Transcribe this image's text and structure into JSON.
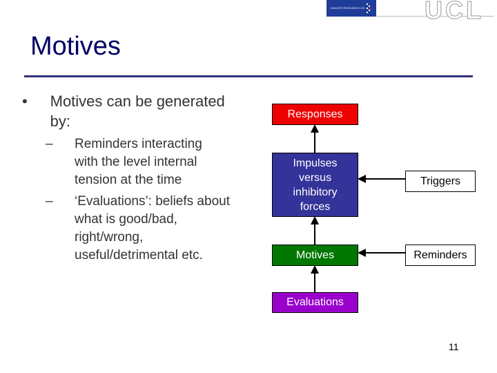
{
  "header": {
    "logo_left_text": "CANCER RESEARCH UK",
    "logo_right_text": "UCL"
  },
  "slide": {
    "title": "Motives",
    "bullets": [
      {
        "text": "Motives can be generated by:",
        "sub": [
          "Reminders interacting with the level internal tension at the time",
          "‘Evaluations’: beliefs about what is good/bad, right/wrong, useful/detrimental etc."
        ]
      }
    ],
    "page_number": "11"
  },
  "diagram": {
    "nodes": {
      "responses": {
        "label": "Responses",
        "color": "#ee0000"
      },
      "impulses": {
        "label": "Impulses versus inhibitory forces",
        "color": "#333399"
      },
      "motives": {
        "label": "Motives",
        "color": "#007700"
      },
      "evaluations": {
        "label": "Evaluations",
        "color": "#9900cc"
      },
      "triggers": {
        "label": "Triggers",
        "color": "#ffffff"
      },
      "reminders": {
        "label": "Reminders",
        "color": "#ffffff"
      }
    },
    "edges": [
      {
        "from": "impulses",
        "to": "responses"
      },
      {
        "from": "motives",
        "to": "impulses"
      },
      {
        "from": "evaluations",
        "to": "motives"
      },
      {
        "from": "triggers",
        "to": "impulses"
      },
      {
        "from": "reminders",
        "to": "motives"
      }
    ]
  }
}
